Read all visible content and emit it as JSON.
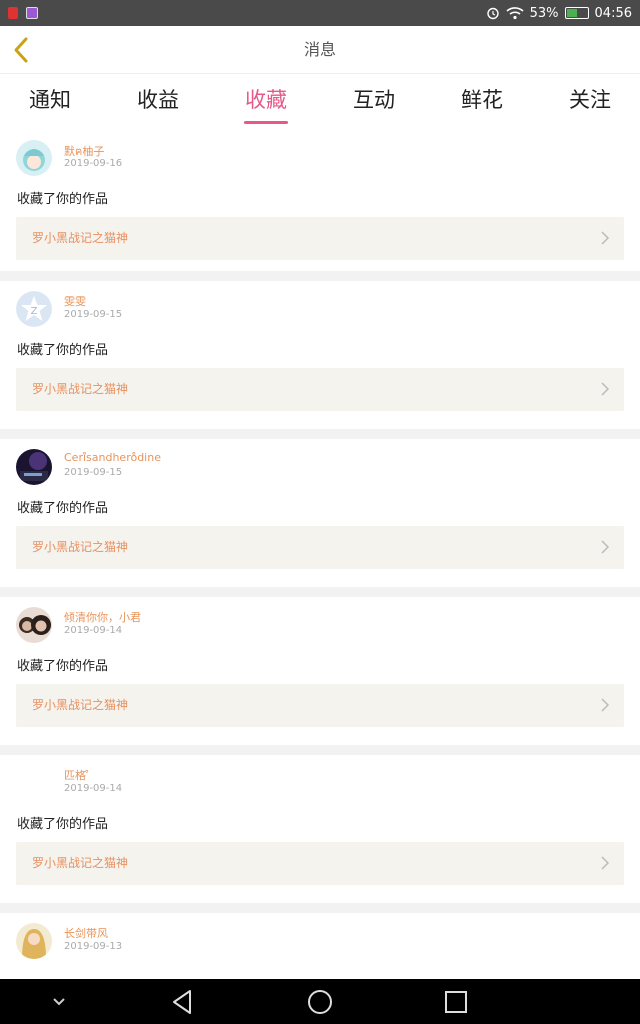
{
  "status_bar": {
    "battery_percent": "53%",
    "battery_level": 0.53,
    "time": "04:56",
    "icons": [
      "app-icon-1",
      "app-icon-2",
      "alarm-icon",
      "wifi-icon",
      "battery-icon"
    ]
  },
  "header": {
    "title": "消息"
  },
  "tabs": [
    {
      "label": "通知"
    },
    {
      "label": "收益"
    },
    {
      "label": "收藏",
      "active": true
    },
    {
      "label": "互动"
    },
    {
      "label": "鲜花"
    },
    {
      "label": "关注"
    }
  ],
  "items": [
    {
      "username": "默ฅ柚子",
      "date": "2019-09-16",
      "action": "收藏了你的作品",
      "work": "罗小黑战记之猫神"
    },
    {
      "username": "雯雯",
      "date": "2019-09-15",
      "action": "收藏了你的作品",
      "work": "罗小黑战记之猫神"
    },
    {
      "username": "Ceri̊sandhero̊dine",
      "date": "2019-09-15",
      "action": "收藏了你的作品",
      "work": "罗小黑战记之猫神"
    },
    {
      "username": "倾清你你，小君",
      "date": "2019-09-14",
      "action": "收藏了你的作品",
      "work": "罗小黑战记之猫神"
    },
    {
      "username": "匹格 ̊",
      "date": "2019-09-14",
      "action": "收藏了你的作品",
      "work": "罗小黑战记之猫神"
    },
    {
      "username": "长剑带风",
      "date": "2019-09-13",
      "action": "",
      "work": ""
    }
  ],
  "colors": {
    "accent": "#e8588a",
    "username": "#e8945a",
    "work_link": "#e89060",
    "card_bg": "#f4f3ee"
  }
}
